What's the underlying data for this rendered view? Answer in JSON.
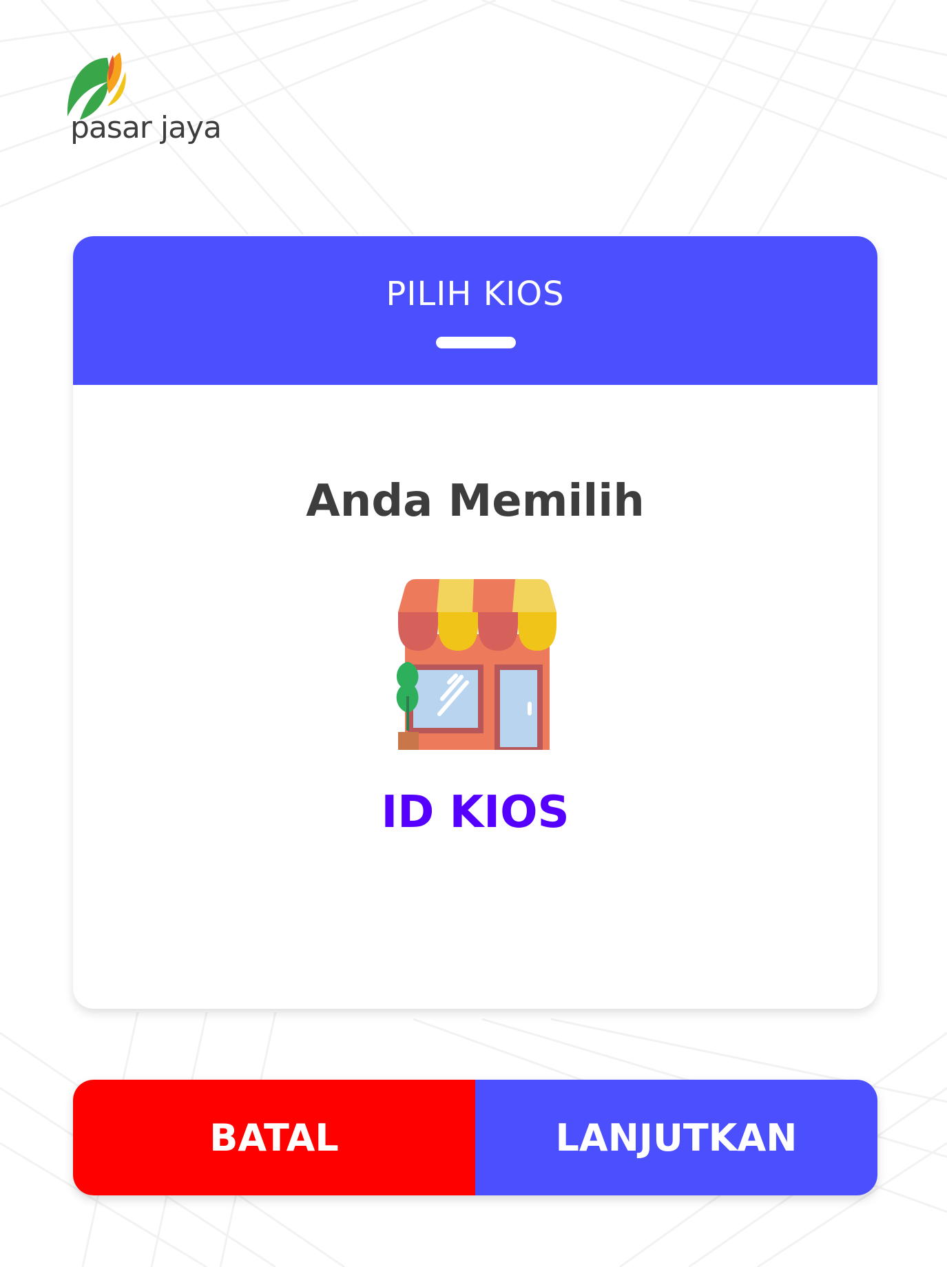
{
  "brand": {
    "name": "pasar jaya",
    "logo_icon": "leaf-logo-icon"
  },
  "dialog": {
    "title": "PILIH KIOS",
    "subtitle": "Anda Memilih",
    "kiosk_icon": "store-icon",
    "kiosk_id": "ID KIOS"
  },
  "actions": {
    "cancel_label": "BATAL",
    "continue_label": "LANJUTKAN"
  },
  "colors": {
    "primary": "#4b4ffe",
    "danger": "#ff0000",
    "kiosk_id_text": "#5500ff",
    "heading_text": "#3d3d3d"
  }
}
